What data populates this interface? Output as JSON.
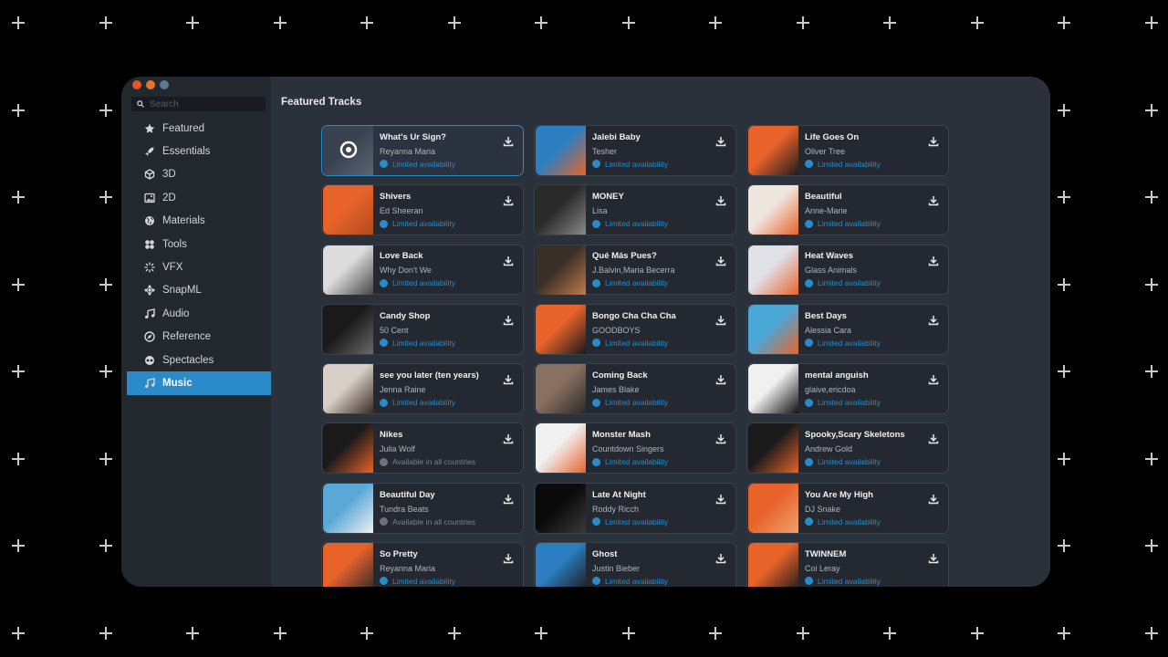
{
  "window": {
    "traffic_colors": [
      "#e2552d",
      "#e6742b",
      "#5b7a8f"
    ]
  },
  "sidebar": {
    "search_placeholder": "Search",
    "items": [
      {
        "label": "Featured",
        "icon": "star-icon"
      },
      {
        "label": "Essentials",
        "icon": "rocket-icon"
      },
      {
        "label": "3D",
        "icon": "cube-icon"
      },
      {
        "label": "2D",
        "icon": "image-icon"
      },
      {
        "label": "Materials",
        "icon": "globe-icon"
      },
      {
        "label": "Tools",
        "icon": "tools-icon"
      },
      {
        "label": "VFX",
        "icon": "sparkle-icon"
      },
      {
        "label": "SnapML",
        "icon": "network-icon"
      },
      {
        "label": "Audio",
        "icon": "note-icon"
      },
      {
        "label": "Reference",
        "icon": "compass-icon"
      },
      {
        "label": "Spectacles",
        "icon": "glasses-icon"
      },
      {
        "label": "Music",
        "icon": "note-icon",
        "active": true
      }
    ]
  },
  "main": {
    "title": "Featured Tracks",
    "tracks": [
      {
        "title": "What's Ur Sign?",
        "artist": "Reyanna Maria",
        "availability": "Limited availability",
        "limited": true,
        "selected": true,
        "art": [
          "#3a4250",
          "#5a6474"
        ]
      },
      {
        "title": "Jalebi Baby",
        "artist": "Tesher",
        "availability": "Limited availability",
        "limited": true,
        "art": [
          "#2b7fc0",
          "#e8632a"
        ]
      },
      {
        "title": "Life Goes On",
        "artist": "Oliver Tree",
        "availability": "Limited availability",
        "limited": true,
        "art": [
          "#e8632a",
          "#1c1c1c"
        ]
      },
      {
        "title": "Shivers",
        "artist": "Ed Sheeran",
        "availability": "Limited availability",
        "limited": true,
        "art": [
          "#e8632a",
          "#b24a1c"
        ]
      },
      {
        "title": "MONEY",
        "artist": "Lisa",
        "availability": "Limited availability",
        "limited": true,
        "art": [
          "#2a2a2a",
          "#8a8a8a"
        ]
      },
      {
        "title": "Beautiful",
        "artist": "Anne-Marie",
        "availability": "Limited availability",
        "limited": true,
        "art": [
          "#f0e6e0",
          "#e8632a"
        ]
      },
      {
        "title": "Love Back",
        "artist": "Why Don't We",
        "availability": "Limited availability",
        "limited": true,
        "art": [
          "#dcdcdc",
          "#444"
        ]
      },
      {
        "title": "Qué Más Pues?",
        "artist": "J.Balvin,Maria Becerra",
        "availability": "Limited availability",
        "limited": true,
        "art": [
          "#3a3028",
          "#c07a4a"
        ]
      },
      {
        "title": "Heat Waves",
        "artist": "Glass Animals",
        "availability": "Limited availability",
        "limited": true,
        "art": [
          "#e0e0e8",
          "#e8632a"
        ]
      },
      {
        "title": "Candy Shop",
        "artist": "50 Cent",
        "availability": "Limited availability",
        "limited": true,
        "art": [
          "#1a1a1a",
          "#6a6a6a"
        ]
      },
      {
        "title": "Bongo Cha Cha Cha",
        "artist": "GOODBOYS",
        "availability": "Limited availability",
        "limited": true,
        "art": [
          "#e8632a",
          "#1a1a1a"
        ]
      },
      {
        "title": "Best Days",
        "artist": "Alessia Cara",
        "availability": "Limited availability",
        "limited": true,
        "art": [
          "#4aa8d8",
          "#e8632a"
        ]
      },
      {
        "title": "see you later (ten years)",
        "artist": "Jenna Raine",
        "availability": "Limited availability",
        "limited": true,
        "art": [
          "#d8d0c8",
          "#3a2a22"
        ]
      },
      {
        "title": "Coming Back",
        "artist": "James Blake",
        "availability": "Limited availability",
        "limited": true,
        "art": [
          "#8a7060",
          "#2a2a2a"
        ]
      },
      {
        "title": "mental anguish",
        "artist": "glaive,ericdoa",
        "availability": "Limited availability",
        "limited": true,
        "art": [
          "#f0f0f0",
          "#111"
        ]
      },
      {
        "title": "Nikes",
        "artist": "Julia Wolf",
        "availability": "Available in all countries",
        "limited": false,
        "art": [
          "#1a1a1a",
          "#e8632a"
        ]
      },
      {
        "title": "Monster Mash",
        "artist": "Countdown Singers",
        "availability": "Limited availability",
        "limited": true,
        "art": [
          "#f0f0f0",
          "#e8632a"
        ]
      },
      {
        "title": "Spooky,Scary Skeletons",
        "artist": "Andrew Gold",
        "availability": "Limited availability",
        "limited": true,
        "art": [
          "#1a1a1a",
          "#e8632a"
        ]
      },
      {
        "title": "Beautiful Day",
        "artist": "Tundra Beats",
        "availability": "Available in all countries",
        "limited": false,
        "art": [
          "#5aa8d8",
          "#f0f0f0"
        ]
      },
      {
        "title": "Late At Night",
        "artist": "Roddy Ricch",
        "availability": "Limited availability",
        "limited": true,
        "art": [
          "#0a0a0a",
          "#3a3a3a"
        ]
      },
      {
        "title": "You Are My High",
        "artist": "DJ Snake",
        "availability": "Limited availability",
        "limited": true,
        "art": [
          "#e8632a",
          "#f0a070"
        ]
      },
      {
        "title": "So Pretty",
        "artist": "Reyanna Maria",
        "availability": "Limited availability",
        "limited": true,
        "art": [
          "#e8632a",
          "#2a2a2a"
        ]
      },
      {
        "title": "Ghost",
        "artist": "Justin Bieber",
        "availability": "Limited availability",
        "limited": true,
        "art": [
          "#2b7fc0",
          "#1a1a1a"
        ]
      },
      {
        "title": "TWINNEM",
        "artist": "Coi Leray",
        "availability": "Limited availability",
        "limited": true,
        "art": [
          "#e8632a",
          "#1a1a1a"
        ]
      }
    ]
  }
}
